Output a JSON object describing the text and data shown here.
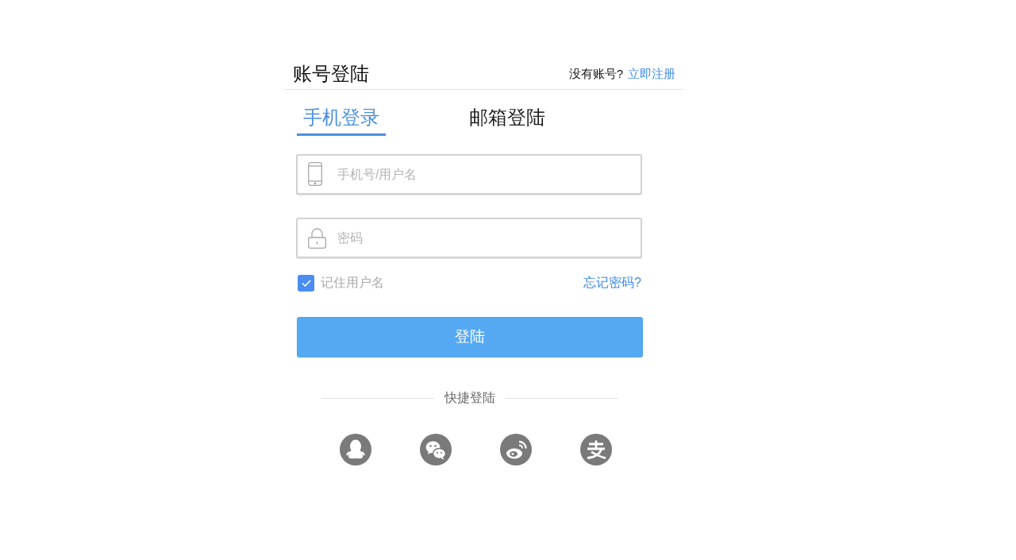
{
  "header": {
    "title": "账号登陆",
    "prompt": "没有账号?",
    "register_link": "立即注册"
  },
  "tabs": [
    {
      "label": "手机登录",
      "selected": true
    },
    {
      "label": "邮箱登陆",
      "selected": false
    }
  ],
  "fields": [
    {
      "kind": "phone",
      "placeholder": "手机号/用户名"
    },
    {
      "kind": "password",
      "placeholder": "密码"
    }
  ],
  "remember": {
    "label": "记住用户名",
    "checked": true
  },
  "forgot_link": "忘记密码?",
  "login_button": "登陆",
  "quick_login": {
    "label": "快捷登陆",
    "providers": [
      {
        "kind": "qq"
      },
      {
        "kind": "wechat"
      },
      {
        "kind": "weibo"
      },
      {
        "kind": "alipay"
      }
    ]
  }
}
